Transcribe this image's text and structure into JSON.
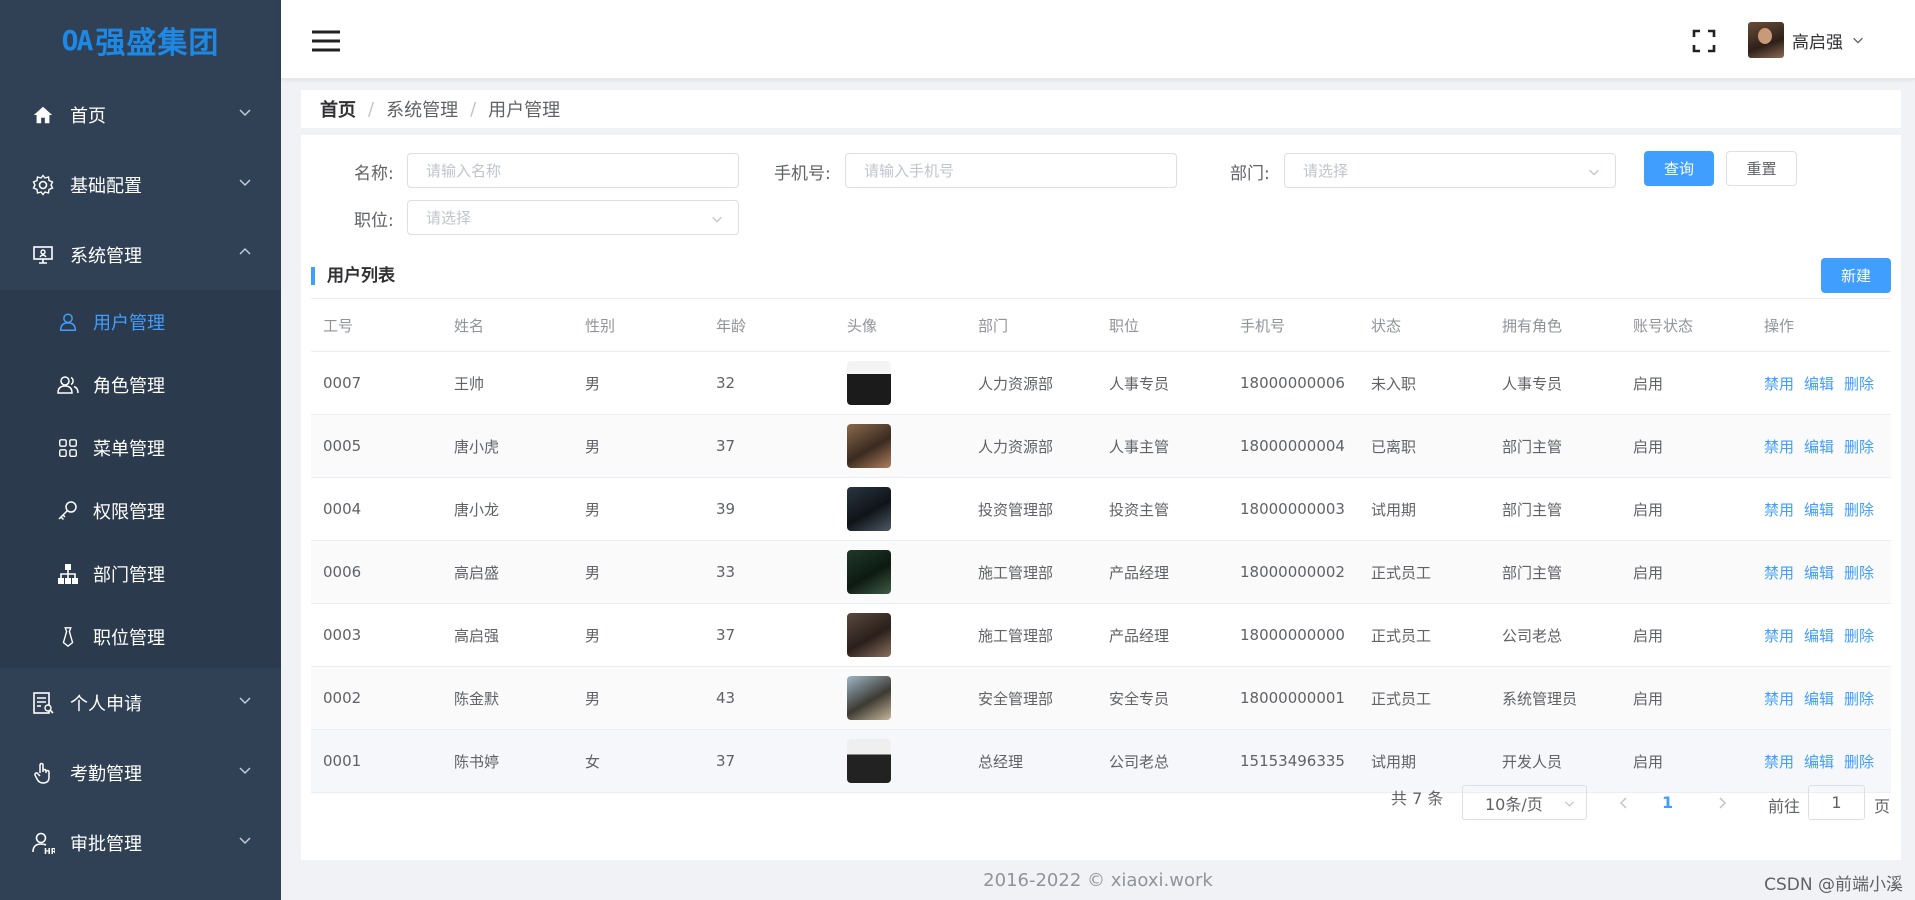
{
  "brand": {
    "logo_mark": "OA",
    "name": "强盛集团",
    "color": "#1e88e5"
  },
  "colors": {
    "sidebar_bg": "#304156",
    "accent": "#409eff"
  },
  "sidebar": {
    "items": [
      {
        "label": "首页",
        "icon": "home-icon"
      },
      {
        "label": "基础配置",
        "icon": "gear-icon"
      },
      {
        "label": "系统管理",
        "icon": "monitor-icon",
        "expanded": true,
        "children": [
          {
            "label": "用户管理",
            "icon": "user-icon",
            "active": true
          },
          {
            "label": "角色管理",
            "icon": "users-icon"
          },
          {
            "label": "菜单管理",
            "icon": "grid-icon"
          },
          {
            "label": "权限管理",
            "icon": "key-icon"
          },
          {
            "label": "部门管理",
            "icon": "org-chart-icon"
          },
          {
            "label": "职位管理",
            "icon": "tie-icon"
          }
        ]
      },
      {
        "label": "个人申请",
        "icon": "document-icon"
      },
      {
        "label": "考勤管理",
        "icon": "hand-icon"
      },
      {
        "label": "审批管理",
        "icon": "approver-icon"
      }
    ]
  },
  "header": {
    "user_name": "高启强"
  },
  "breadcrumb": [
    "首页",
    "系统管理",
    "用户管理"
  ],
  "filters": {
    "name_label": "名称:",
    "name_placeholder": "请输入名称",
    "phone_label": "手机号:",
    "phone_placeholder": "请输入手机号",
    "dept_label": "部门:",
    "dept_placeholder": "请选择",
    "position_label": "职位:",
    "position_placeholder": "请选择",
    "query_button": "查询",
    "reset_button": "重置"
  },
  "list": {
    "title": "用户列表",
    "new_button": "新建",
    "columns": [
      "工号",
      "姓名",
      "性别",
      "年龄",
      "头像",
      "部门",
      "职位",
      "手机号",
      "状态",
      "拥有角色",
      "账号状态",
      "操作"
    ],
    "actions": [
      "禁用",
      "编辑",
      "删除"
    ],
    "rows": [
      {
        "id": "0007",
        "name": "王帅",
        "gender": "男",
        "age": "32",
        "dept": "人力资源部",
        "position": "人事专员",
        "phone": "18000000006",
        "status": "未入职",
        "role": "人事专员",
        "account": "启用"
      },
      {
        "id": "0005",
        "name": "唐小虎",
        "gender": "男",
        "age": "37",
        "dept": "人力资源部",
        "position": "人事主管",
        "phone": "18000000004",
        "status": "已离职",
        "role": "部门主管",
        "account": "启用"
      },
      {
        "id": "0004",
        "name": "唐小龙",
        "gender": "男",
        "age": "39",
        "dept": "投资管理部",
        "position": "投资主管",
        "phone": "18000000003",
        "status": "试用期",
        "role": "部门主管",
        "account": "启用"
      },
      {
        "id": "0006",
        "name": "高启盛",
        "gender": "男",
        "age": "33",
        "dept": "施工管理部",
        "position": "产品经理",
        "phone": "18000000002",
        "status": "正式员工",
        "role": "部门主管",
        "account": "启用"
      },
      {
        "id": "0003",
        "name": "高启强",
        "gender": "男",
        "age": "37",
        "dept": "施工管理部",
        "position": "产品经理",
        "phone": "18000000000",
        "status": "正式员工",
        "role": "公司老总",
        "account": "启用"
      },
      {
        "id": "0002",
        "name": "陈金默",
        "gender": "男",
        "age": "43",
        "dept": "安全管理部",
        "position": "安全专员",
        "phone": "18000000001",
        "status": "正式员工",
        "role": "系统管理员",
        "account": "启用"
      },
      {
        "id": "0001",
        "name": "陈书婷",
        "gender": "女",
        "age": "37",
        "dept": "总经理",
        "position": "公司老总",
        "phone": "15153496335",
        "status": "试用期",
        "role": "开发人员",
        "account": "启用"
      }
    ]
  },
  "pagination": {
    "total_text": "共 7 条",
    "page_size": "10条/页",
    "current_page": "1",
    "goto_label": "前往",
    "goto_value": "1",
    "page_suffix": "页"
  },
  "footer": {
    "copyright": "2016-2022 © xiaoxi.work",
    "watermark": "CSDN @前端小溪"
  }
}
